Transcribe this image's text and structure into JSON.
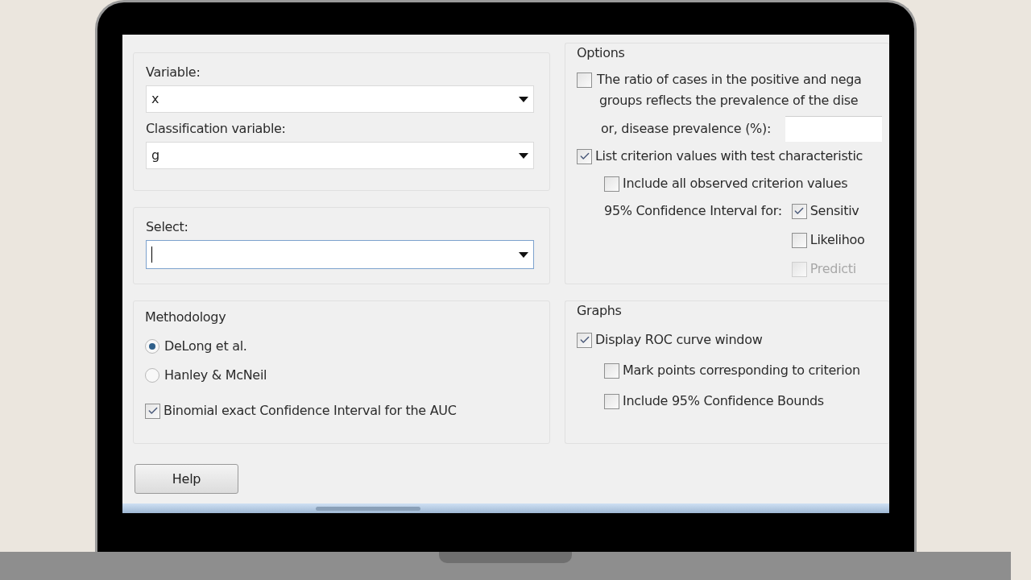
{
  "variables": {
    "fields": [
      {
        "label": "Variable:",
        "value": "x"
      },
      {
        "label": "Classification variable:",
        "value": "g"
      }
    ]
  },
  "select": {
    "label": "Select:",
    "focused": true
  },
  "methodology": {
    "title": "Methodology",
    "options": [
      {
        "label": "DeLong et al.",
        "selected": true
      },
      {
        "label": "Hanley & McNeil",
        "selected": false
      }
    ],
    "checkbox": {
      "label": "Binomial exact Confidence Interval for the AUC",
      "checked": true
    }
  },
  "options": {
    "title": "Options",
    "ratio": {
      "lines": [
        "The ratio of cases in the positive and nega",
        "groups reflects the prevalence of the dise"
      ],
      "checked": false
    },
    "prevalence": {
      "label": "or, disease prevalence (%):"
    },
    "list_criterion": {
      "label": "List criterion values with test characteristic",
      "checked": true,
      "children": [
        {
          "label": "Include all observed criterion values",
          "checked": false
        }
      ]
    },
    "ci": {
      "label": "95% Confidence Interval for:",
      "items": [
        {
          "label": "Sensitiv",
          "checked": true,
          "disabled": false
        },
        {
          "label": "Likelihoo",
          "checked": false,
          "disabled": false
        },
        {
          "label": "Predicti",
          "checked": false,
          "disabled": true
        }
      ]
    }
  },
  "graphs": {
    "title": "Graphs",
    "display": {
      "label": "Display ROC curve window",
      "checked": true,
      "children": [
        {
          "label": "Mark points corresponding to criterion",
          "checked": false
        },
        {
          "label": "Include 95% Confidence Bounds",
          "checked": false
        }
      ]
    }
  },
  "help_button": "Help"
}
